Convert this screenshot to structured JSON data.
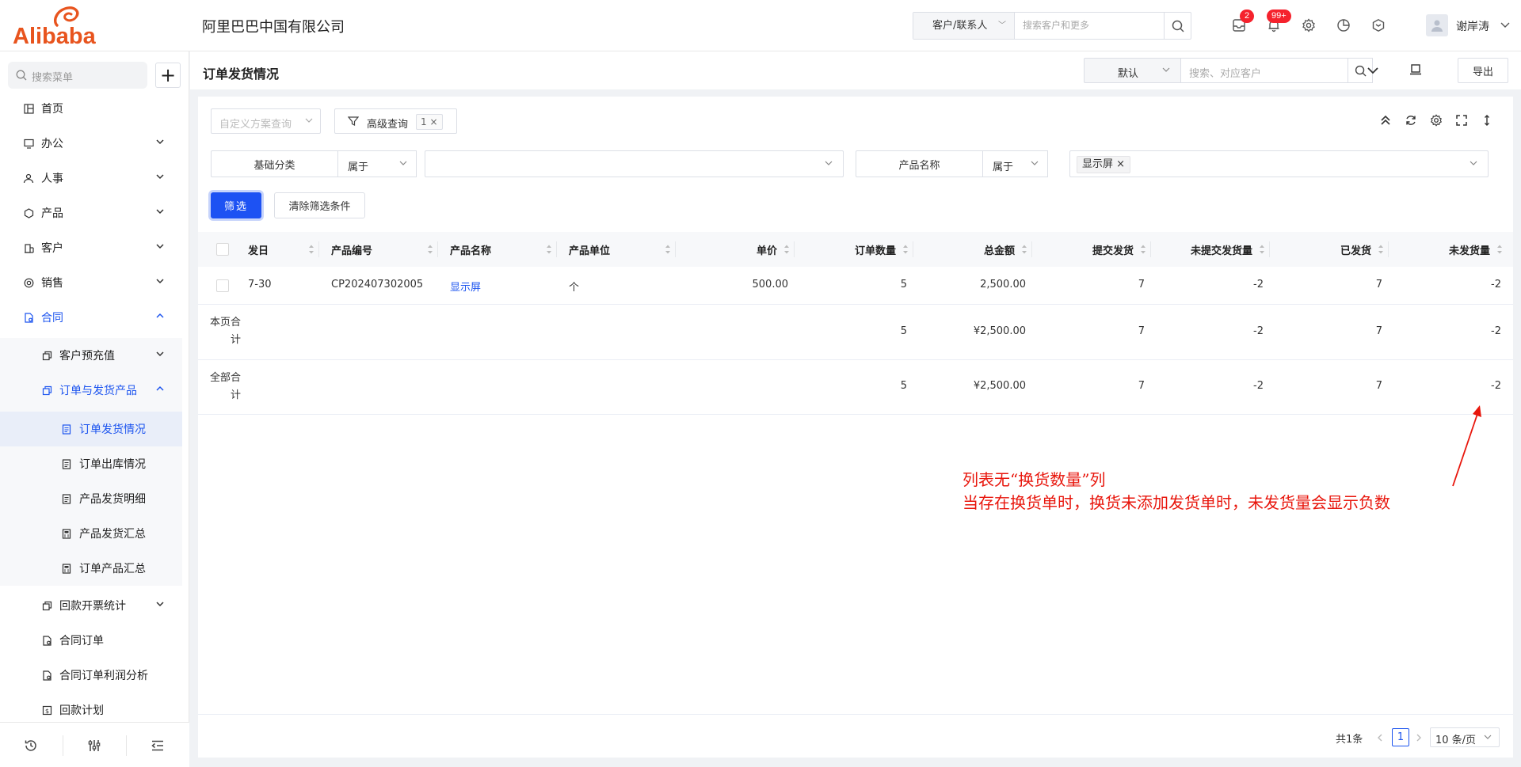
{
  "header": {
    "logo_text": "Alibaba",
    "company": "阿里巴巴中国有限公司",
    "search_scope": "客户/联系人",
    "search_placeholder": "搜索客户和更多",
    "msg_badge": "2",
    "notice_badge": "99+",
    "user_name": "谢岸涛"
  },
  "sidebar": {
    "search_placeholder": "搜索菜单",
    "items": [
      {
        "label": "首页"
      },
      {
        "label": "办公"
      },
      {
        "label": "人事"
      },
      {
        "label": "产品"
      },
      {
        "label": "客户"
      },
      {
        "label": "销售"
      },
      {
        "label": "合同"
      }
    ],
    "sub": [
      {
        "label": "客户预充值"
      },
      {
        "label": "订单与发货产品"
      },
      {
        "label": "订单发货情况"
      },
      {
        "label": "订单出库情况"
      },
      {
        "label": "产品发货明细"
      },
      {
        "label": "产品发货汇总"
      },
      {
        "label": "订单产品汇总"
      },
      {
        "label": "回款开票统计"
      },
      {
        "label": "合同订单"
      },
      {
        "label": "合同订单利润分析"
      },
      {
        "label": "回款计划"
      }
    ]
  },
  "page": {
    "title": "订单发货情况",
    "view_select": "默认",
    "search_placeholder": "搜索、对应客户",
    "export_label": "导出"
  },
  "filters": {
    "scheme_placeholder": "自定义方案查询",
    "advanced_label": "高级查询",
    "advanced_count": "1",
    "f1_label": "基础分类",
    "f1_op": "属于",
    "f2_label": "产品名称",
    "f2_op": "属于",
    "f2_tag": "显示屏",
    "filter_btn": "筛选",
    "clear_btn": "清除筛选条件"
  },
  "table": {
    "columns": [
      "发日",
      "产品编号",
      "产品名称",
      "产品单位",
      "单价",
      "订单数量",
      "总金额",
      "提交发货",
      "未提交发货量",
      "已发货",
      "未发货量"
    ],
    "rows": [
      [
        "7-30",
        "CP202407302005",
        "显示屏",
        "个",
        "500.00",
        "5",
        "2,500.00",
        "7",
        "-2",
        "7",
        "-2"
      ]
    ],
    "page_total_label": "本页合计",
    "page_total": [
      "5",
      "¥2,500.00",
      "7",
      "-2",
      "7",
      "-2"
    ],
    "all_total_label": "全部合计",
    "all_total": [
      "5",
      "¥2,500.00",
      "7",
      "-2",
      "7",
      "-2"
    ]
  },
  "annotation": {
    "line1": "列表无“换货数量”列",
    "line2": "当存在换货单时，换货未添加发货单时，未发货量会显示负数",
    "color": "#e8160c"
  },
  "pagination": {
    "total": "共1条",
    "current": "1",
    "page_size": "10 条/页"
  }
}
